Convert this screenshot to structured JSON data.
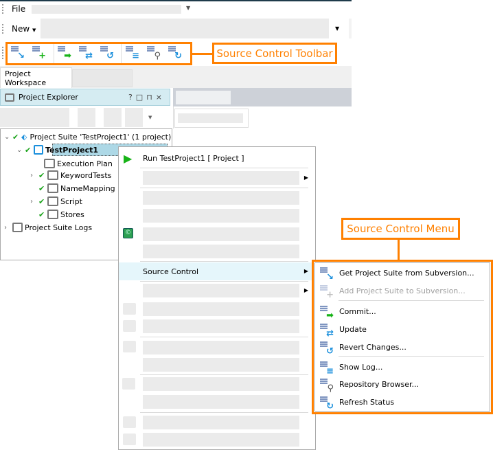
{
  "menubar": {
    "file": "File",
    "new": "New"
  },
  "toolbar": {
    "label": "Source Control Toolbar",
    "icons": [
      "get-project-suite-icon",
      "add-project-suite-icon",
      "commit-icon",
      "update-icon",
      "revert-icon",
      "show-log-icon",
      "repository-browser-icon",
      "refresh-status-icon"
    ]
  },
  "tabs": [
    {
      "label": "Project Workspace"
    }
  ],
  "explorer": {
    "title": "Project Explorer",
    "controls": [
      "?",
      "□",
      "⊓",
      "×"
    ]
  },
  "tree": [
    {
      "label": "Project Suite 'TestProject1' (1 project)"
    },
    {
      "label": "TestProject1"
    },
    {
      "label": "Execution Plan"
    },
    {
      "label": "KeywordTests"
    },
    {
      "label": "NameMapping"
    },
    {
      "label": "Script"
    },
    {
      "label": "Stores"
    },
    {
      "label": "Project Suite Logs"
    }
  ],
  "context_menu": {
    "run": "Run TestProject1  [ Project ]",
    "source_control": "Source Control"
  },
  "source_menu": {
    "label": "Source Control Menu",
    "items": [
      {
        "label": "Get Project Suite from Subversion...",
        "enabled": true
      },
      {
        "label": "Add Project Suite to Subversion...",
        "enabled": false
      },
      {
        "label": "Commit...",
        "enabled": true
      },
      {
        "label": "Update",
        "enabled": true
      },
      {
        "label": "Revert Changes...",
        "enabled": true
      },
      {
        "label": "Show Log...",
        "enabled": true
      },
      {
        "label": "Repository Browser...",
        "enabled": true
      },
      {
        "label": "Refresh Status",
        "enabled": true
      }
    ]
  },
  "colors": {
    "accent": "#ff8000",
    "check": "#1aa31a",
    "highlight": "#e5f6fb",
    "explorer_header": "#d5ecf2"
  }
}
